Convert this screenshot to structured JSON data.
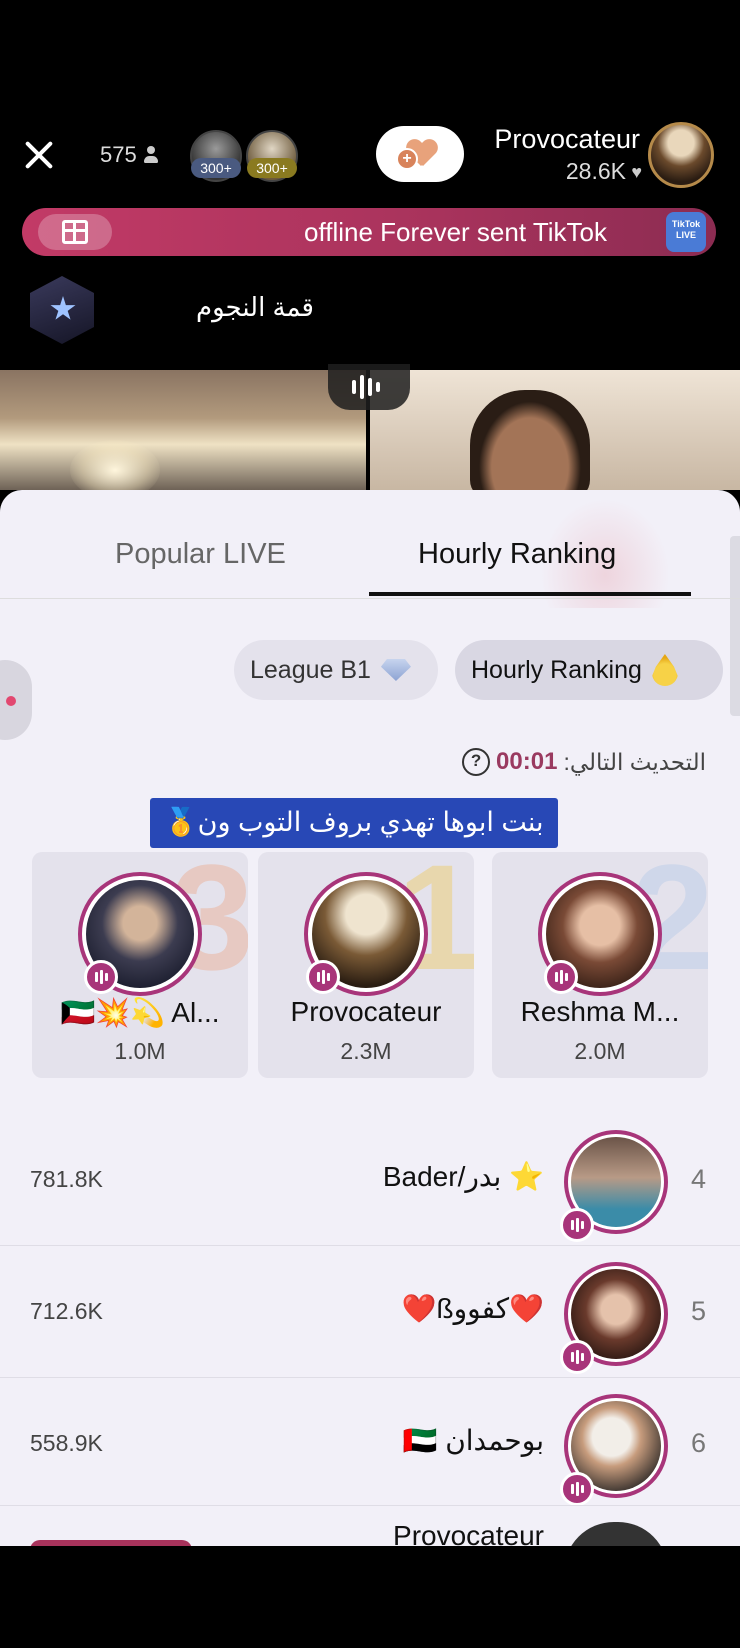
{
  "top_bar": {
    "viewer_count": "575",
    "viewer_badges": [
      "300+",
      "300+"
    ],
    "host_name": "Provocateur",
    "host_likes": "28.6K"
  },
  "gift_banner": {
    "text": "offline Forever sent TikTok",
    "badge_text": "TikTok LIVE"
  },
  "rank_title": "قمة النجوم",
  "panel": {
    "tabs": [
      {
        "label": "Popular LIVE",
        "active": false
      },
      {
        "label": "Hourly Ranking",
        "active": true
      }
    ],
    "filters": {
      "league": "League B1",
      "hourly": "Hourly Ranking"
    },
    "next_update_label": "التحديث التالي:",
    "next_update_time": "00:01",
    "help_icon": "?",
    "caption": "بنت ابوها تهدي بروف التوب ون🥇",
    "podium": [
      {
        "rank": "3",
        "name": "🇰🇼💥💫 Al...",
        "score": "1.0M"
      },
      {
        "rank": "1",
        "name": "Provocateur",
        "score": "2.3M"
      },
      {
        "rank": "2",
        "name": "Reshma M...",
        "score": "2.0M"
      }
    ],
    "rows": [
      {
        "rank": "4",
        "name": "⭐ بدر/Bader",
        "score": "781.8K"
      },
      {
        "rank": "5",
        "name": "❤️كفووß❤️",
        "score": "712.6K"
      },
      {
        "rank": "6",
        "name": "بوحمدان 🇦🇪",
        "score": "558.9K"
      }
    ],
    "partial_row_name": "Provocateur"
  },
  "colors": {
    "accent": "#a8357a",
    "banner": "#c23a66",
    "caption_bg": "#2848b6",
    "panel_bg": "#f2f0f8"
  }
}
